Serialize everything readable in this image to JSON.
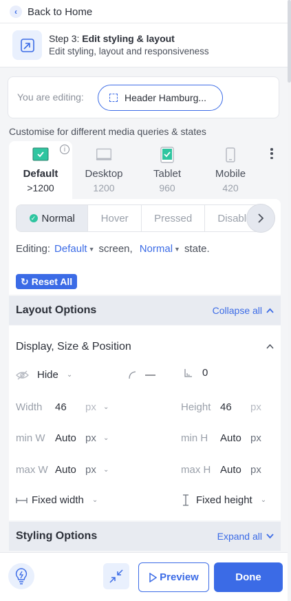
{
  "back": {
    "label": "Back to Home"
  },
  "step": {
    "prefix": "Step 3:",
    "title": "Edit styling & layout",
    "subtitle": "Edit styling, layout and responsiveness"
  },
  "editing": {
    "label": "You are editing:",
    "element": "Header Hamburg..."
  },
  "customise_text": "Customise for different media queries & states",
  "breakpoints": [
    {
      "name": "Default",
      "size": ">1200",
      "active": true
    },
    {
      "name": "Desktop",
      "size": "1200",
      "active": false
    },
    {
      "name": "Tablet",
      "size": "960",
      "active": false
    },
    {
      "name": "Mobile",
      "size": "420",
      "active": false
    }
  ],
  "states": [
    "Normal",
    "Hover",
    "Pressed",
    "Disabl"
  ],
  "editing_line": {
    "prefix": "Editing:",
    "screen": "Default",
    "screen_suffix": "screen,",
    "state": "Normal",
    "state_suffix": "state."
  },
  "reset_all": "Reset All",
  "layout_options": {
    "title": "Layout Options",
    "toggle": "Collapse all"
  },
  "display_section": {
    "title": "Display, Size & Position",
    "hide": "Hide",
    "radius_value": "—",
    "offset_value": "0",
    "width_label": "Width",
    "width_value": "46",
    "width_unit": "px",
    "height_label": "Height",
    "height_value": "46",
    "height_unit": "px",
    "min_w_label": "min W",
    "min_w_value": "Auto",
    "min_w_unit": "px",
    "min_h_label": "min H",
    "min_h_value": "Auto",
    "min_h_unit": "px",
    "max_w_label": "max W",
    "max_w_value": "Auto",
    "max_w_unit": "px",
    "max_h_label": "max H",
    "max_h_value": "Auto",
    "max_h_unit": "px",
    "fixed_width": "Fixed width",
    "fixed_height": "Fixed height"
  },
  "styling_options": {
    "title": "Styling Options",
    "toggle": "Expand all"
  },
  "footer": {
    "preview": "Preview",
    "done": "Done"
  },
  "colors": {
    "accent": "#3b6be6",
    "check": "#2fc5a0",
    "panel_bg": "#f4f5f7"
  }
}
